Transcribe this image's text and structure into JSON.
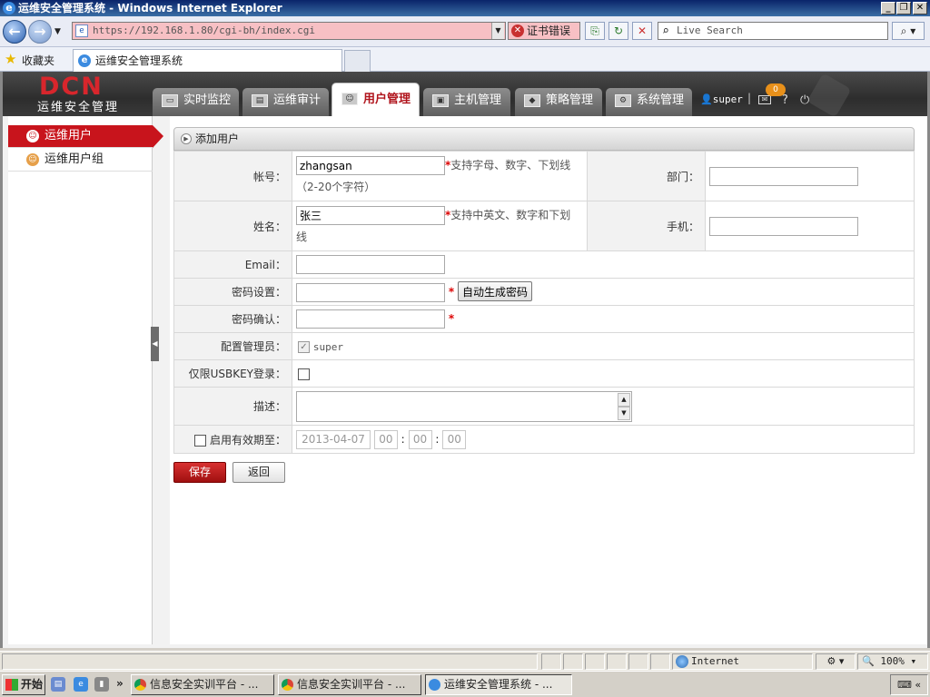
{
  "window": {
    "title": "运维安全管理系统 - Windows Internet Explorer",
    "controls": [
      "_",
      "❐",
      "✕"
    ]
  },
  "browser": {
    "url": "https://192.168.1.80/cgi-bh/index.cgi",
    "cert_error": "证书错误",
    "search_placeholder": "Live Search",
    "favorites_label": "收藏夹",
    "tab_title": "运维安全管理系统"
  },
  "app": {
    "logo": "DCN",
    "logo_sub": "运维安全管理",
    "nav_tabs": [
      {
        "label": "实时监控",
        "icon": "monitor-icon"
      },
      {
        "label": "运维审计",
        "icon": "audit-icon"
      },
      {
        "label": "用户管理",
        "icon": "user-icon",
        "active": true
      },
      {
        "label": "主机管理",
        "icon": "host-icon"
      },
      {
        "label": "策略管理",
        "icon": "policy-icon"
      },
      {
        "label": "系统管理",
        "icon": "settings-icon"
      }
    ],
    "current_user": "super",
    "mail_count": "0",
    "accent_color": "#c8141c"
  },
  "sidebar": {
    "items": [
      {
        "label": "运维用户",
        "active": true
      },
      {
        "label": "运维用户组",
        "active": false
      }
    ]
  },
  "form": {
    "section_title": "添加用户",
    "account_label": "帐号：",
    "account_value": "zhangsan",
    "account_hint": "支持字母、数字、下划线",
    "account_hint2": "（2-20个字符）",
    "dept_label": "部门：",
    "dept_value": "",
    "name_label": "姓名：",
    "name_value": "张三",
    "name_hint": "支持中英文、数字和下划",
    "name_hint2": "线",
    "phone_label": "手机：",
    "phone_value": "",
    "email_label": "Email：",
    "email_value": "",
    "password_label": "密码设置：",
    "password_value": "",
    "autogen_label": "自动生成密码",
    "confirm_label": "密码确认：",
    "confirm_value": "",
    "admin_label": "配置管理员：",
    "admin_value": "super",
    "usbkey_label": "仅限USBKEY登录：",
    "desc_label": "描述：",
    "desc_value": "",
    "expire_label": "启用有效期至：",
    "expire_date": "2013-04-07",
    "expire_hour": "00",
    "expire_min": "00",
    "expire_sec": "00",
    "save_label": "保存",
    "back_label": "返回"
  },
  "statusbar": {
    "zone": "Internet",
    "zoom": "100%"
  },
  "taskbar": {
    "start": "开始",
    "tasks": [
      {
        "label": "信息安全实训平台 - ...",
        "icon": "chrome-icon"
      },
      {
        "label": "信息安全实训平台 - ...",
        "icon": "chrome-icon"
      },
      {
        "label": "运维安全管理系统 - ...",
        "icon": "ie-icon",
        "active": true
      }
    ]
  }
}
